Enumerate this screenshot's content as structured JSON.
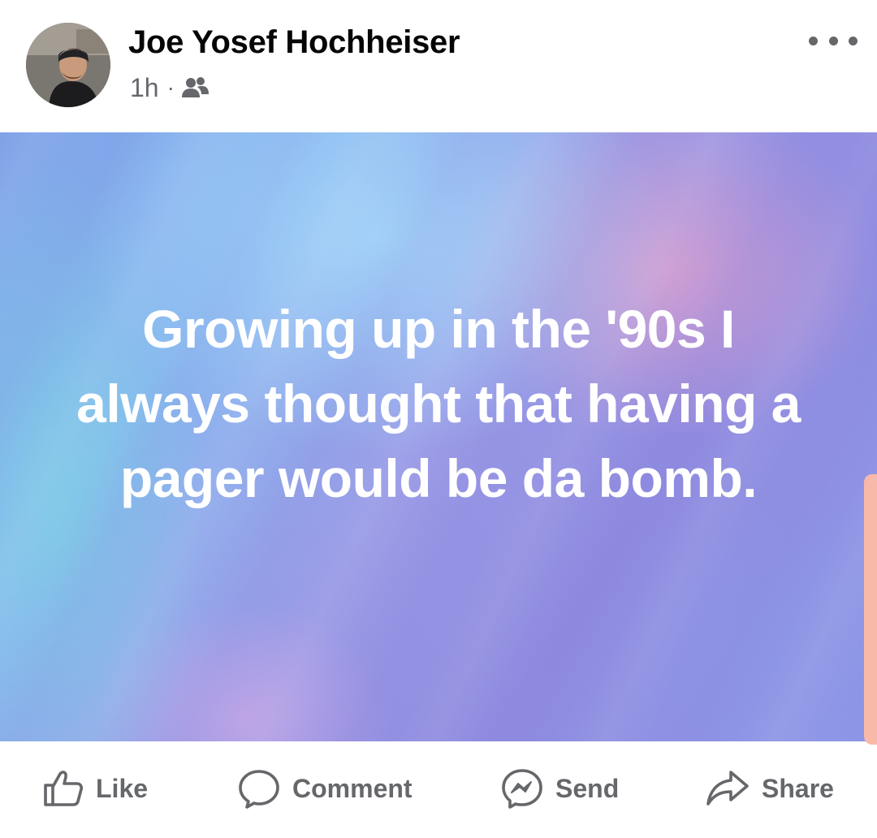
{
  "post": {
    "author": "Joe Yosef Hochheiser",
    "time": "1h",
    "separator": "·",
    "audience_icon": "friends-icon",
    "more_icon": "more-dots-icon",
    "text": "Growing up in the '90s I always thought that having a pager would be da bomb.",
    "text_color": "#ffffff"
  },
  "actions": {
    "like": {
      "label": "Like",
      "icon": "thumbs-up-icon"
    },
    "comment": {
      "label": "Comment",
      "icon": "comment-icon"
    },
    "send": {
      "label": "Send",
      "icon": "messenger-icon"
    },
    "share": {
      "label": "Share",
      "icon": "share-arrow-icon"
    }
  },
  "colors": {
    "secondary_text": "#65676b",
    "primary_text": "#050505",
    "scroll_accent": "#f9b9a8"
  }
}
